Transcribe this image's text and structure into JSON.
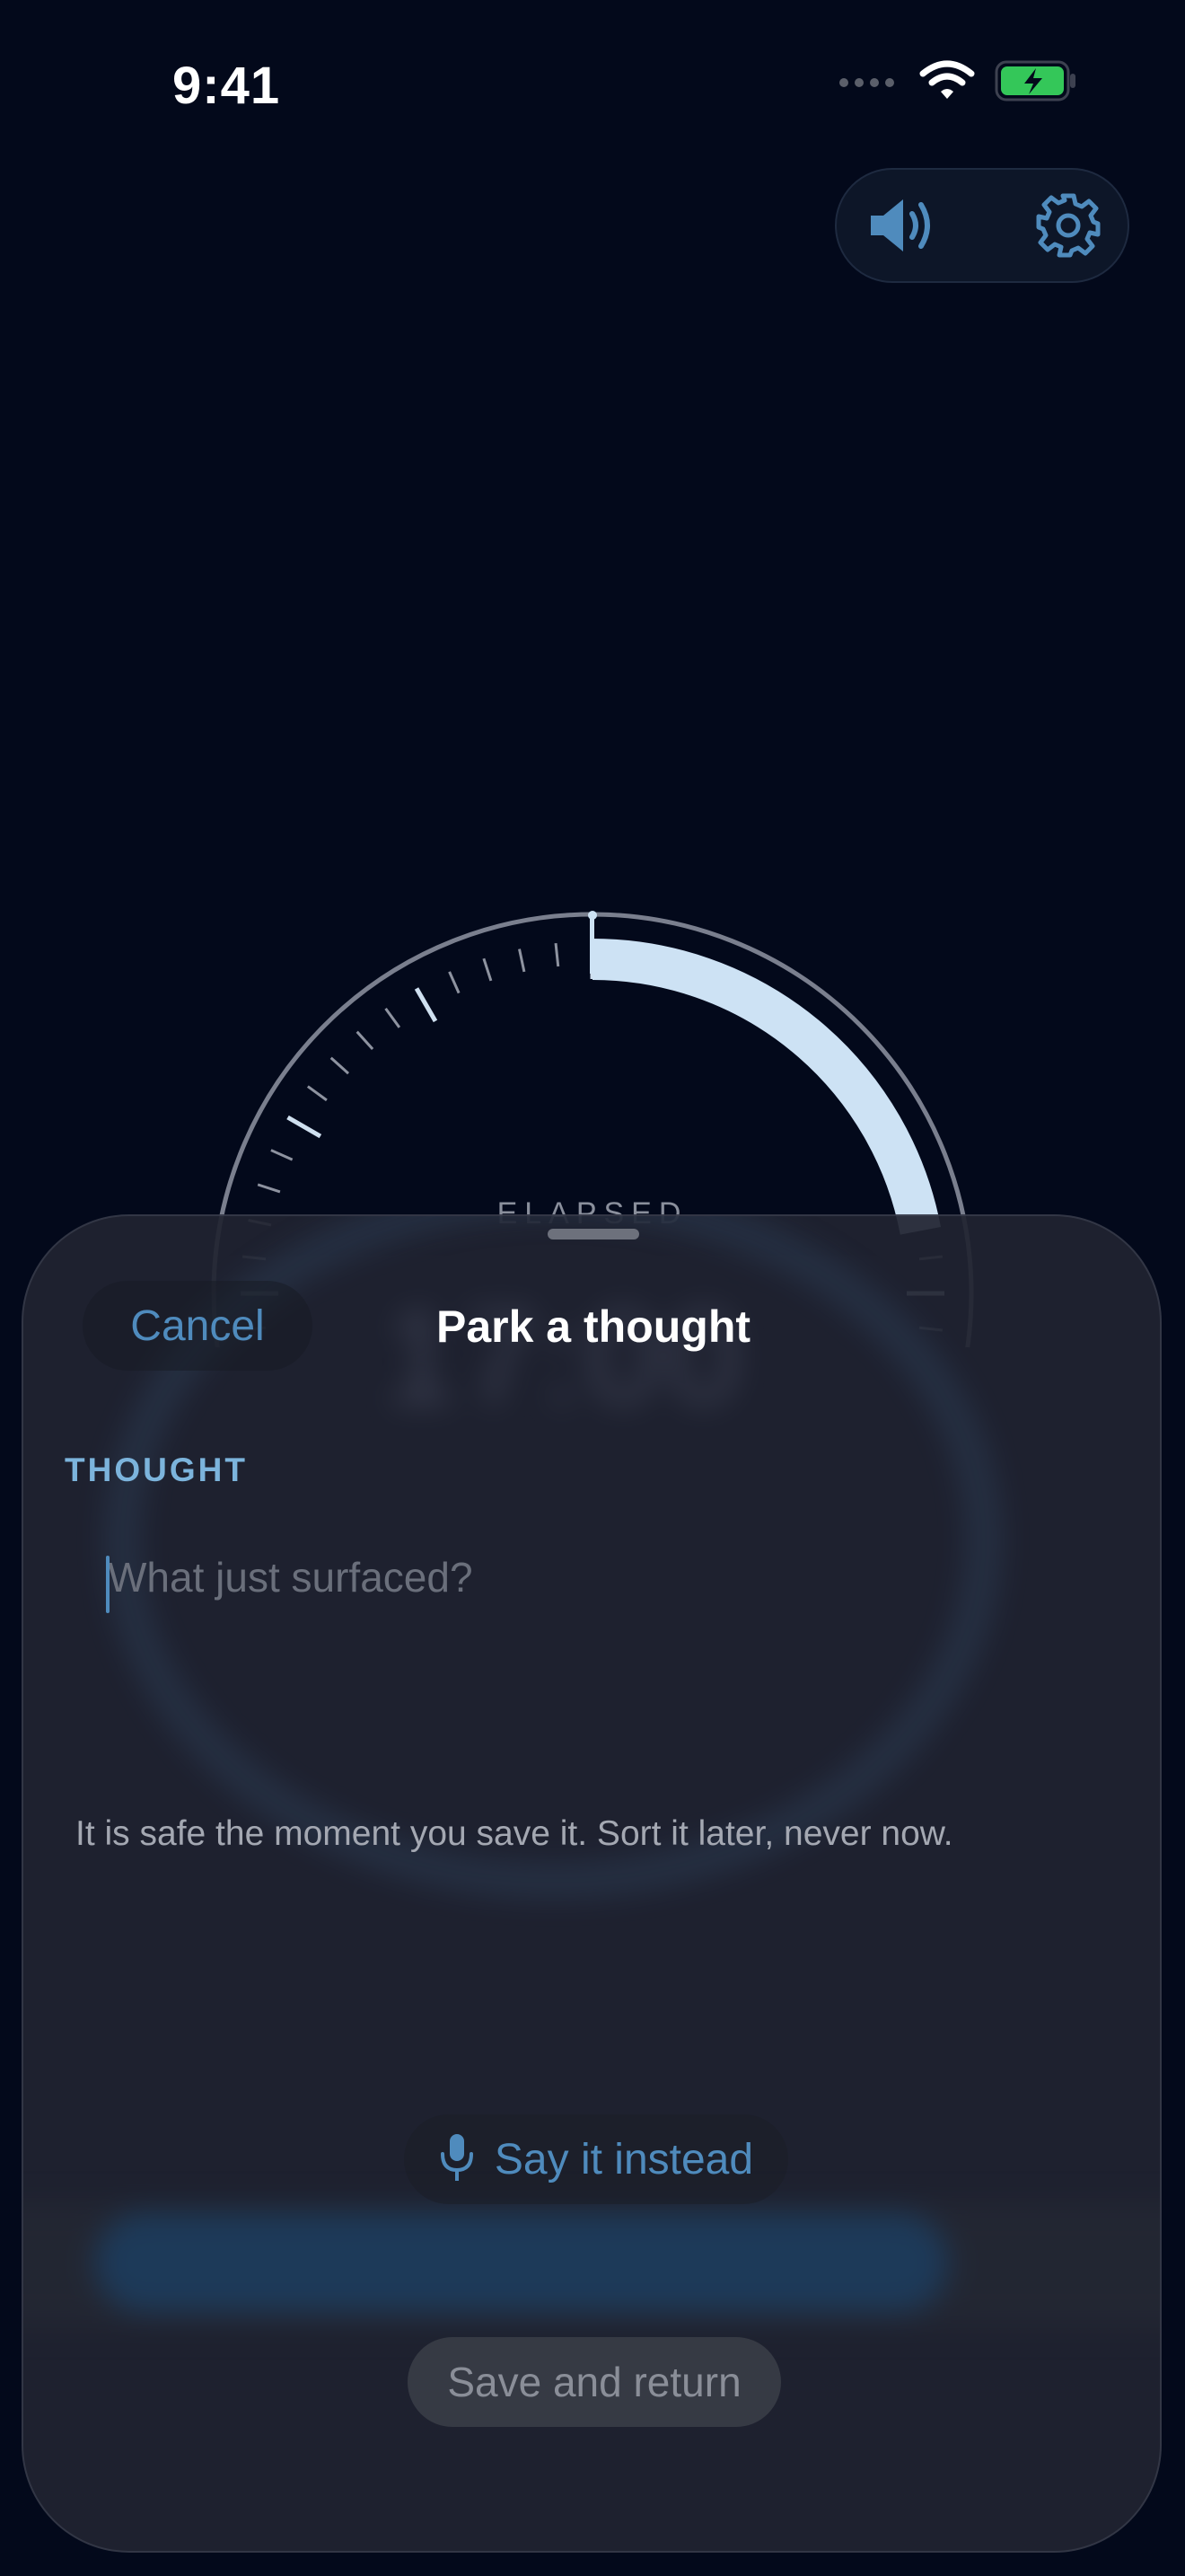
{
  "status": {
    "time": "9:41"
  },
  "toolbar": {
    "sound_icon": "speaker-wave-icon",
    "settings_icon": "gear-icon"
  },
  "timer": {
    "label": "ELAPSED",
    "value": "17:00",
    "progress_fraction": 0.22
  },
  "sheet": {
    "cancel_label": "Cancel",
    "title": "Park a thought",
    "field_label": "THOUGHT",
    "input_value": "",
    "input_placeholder": "What just surfaced?",
    "help_text": "It is safe the moment you save it. Sort it later, never now.",
    "say_label": "Say it instead",
    "save_label": "Save and return"
  },
  "colors": {
    "background": "#03091b",
    "accent": "#4f8bbd",
    "section_label": "#7cb4dc",
    "progress_arc": "#cde2f4",
    "battery": "#34c759"
  }
}
